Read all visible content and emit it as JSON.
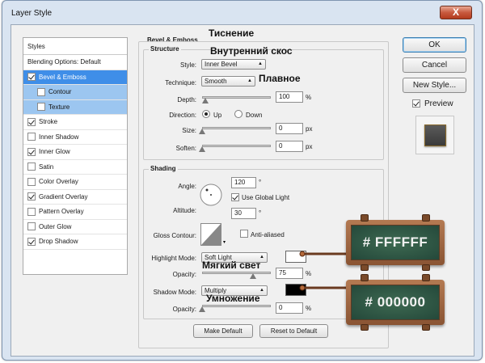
{
  "window": {
    "title": "Layer Style",
    "close_glyph": "X"
  },
  "styles": {
    "header": "Styles",
    "items": [
      {
        "label": "Blending Options: Default",
        "has_checkbox": false,
        "checked": false
      },
      {
        "label": "Bevel & Emboss",
        "has_checkbox": true,
        "checked": true,
        "selected": true
      },
      {
        "label": "Contour",
        "has_checkbox": true,
        "checked": false,
        "sub": true
      },
      {
        "label": "Texture",
        "has_checkbox": true,
        "checked": false,
        "sub": true
      },
      {
        "label": "Stroke",
        "has_checkbox": true,
        "checked": true
      },
      {
        "label": "Inner Shadow",
        "has_checkbox": true,
        "checked": false
      },
      {
        "label": "Inner Glow",
        "has_checkbox": true,
        "checked": true
      },
      {
        "label": "Satin",
        "has_checkbox": true,
        "checked": false
      },
      {
        "label": "Color Overlay",
        "has_checkbox": true,
        "checked": false
      },
      {
        "label": "Gradient Overlay",
        "has_checkbox": true,
        "checked": true
      },
      {
        "label": "Pattern Overlay",
        "has_checkbox": true,
        "checked": false
      },
      {
        "label": "Outer Glow",
        "has_checkbox": true,
        "checked": false
      },
      {
        "label": "Drop Shadow",
        "has_checkbox": true,
        "checked": true
      }
    ]
  },
  "bevel": {
    "title": "Bevel & Emboss",
    "structure": {
      "title": "Structure",
      "style_label": "Style:",
      "style_value": "Inner Bevel",
      "technique_label": "Technique:",
      "technique_value": "Smooth",
      "depth_label": "Depth:",
      "depth_value": "100",
      "depth_unit": "%",
      "direction_label": "Direction:",
      "direction_up": "Up",
      "direction_down": "Down",
      "size_label": "Size:",
      "size_value": "0",
      "size_unit": "px",
      "soften_label": "Soften:",
      "soften_value": "0",
      "soften_unit": "px"
    },
    "shading": {
      "title": "Shading",
      "angle_label": "Angle:",
      "angle_value": "120",
      "angle_unit": "°",
      "use_global_light": "Use Global Light",
      "altitude_label": "Altitude:",
      "altitude_value": "30",
      "altitude_unit": "°",
      "gloss_contour_label": "Gloss Contour:",
      "anti_aliased": "Anti-aliased",
      "highlight_mode_label": "Highlight Mode:",
      "highlight_mode_value": "Soft Light",
      "highlight_opacity_label": "Opacity:",
      "highlight_opacity_value": "75",
      "highlight_opacity_unit": "%",
      "shadow_mode_label": "Shadow Mode:",
      "shadow_mode_value": "Multiply",
      "shadow_opacity_label": "Opacity:",
      "shadow_opacity_value": "0",
      "shadow_opacity_unit": "%",
      "highlight_color": "#ffffff",
      "shadow_color": "#000000"
    },
    "make_default": "Make Default",
    "reset_default": "Reset to Default"
  },
  "side": {
    "ok": "OK",
    "cancel": "Cancel",
    "new_style": "New Style...",
    "preview": "Preview"
  },
  "annotations": {
    "tisnenie": "Тиснение",
    "inner_bevel": "Внутренний скос",
    "smooth": "Плавное",
    "soft_light": "Мягкий свет",
    "multiply": "Умножение",
    "highlight_hex": "# FFFFFF",
    "shadow_hex": "# 000000"
  },
  "colors": {
    "accent_selected": "#3f8ee8",
    "chalkboard": "#2f5a46",
    "frame_wood": "#a06640"
  }
}
